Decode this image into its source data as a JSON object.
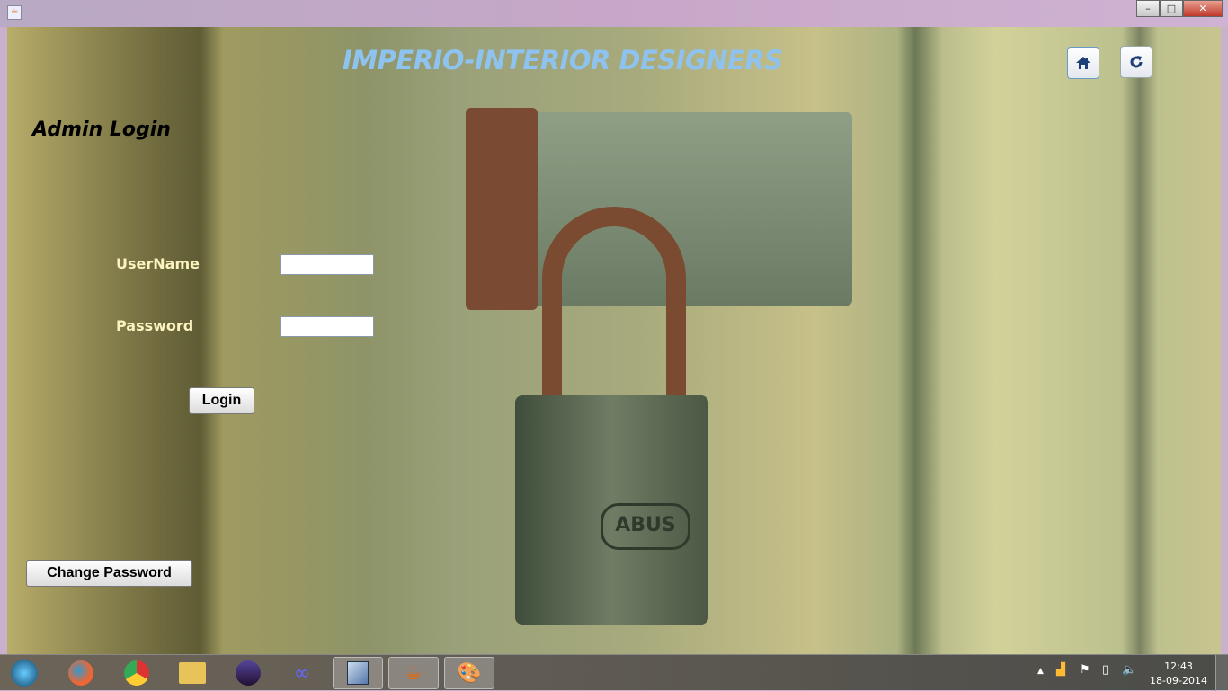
{
  "window": {
    "minimize": "–",
    "maximize": "□",
    "close": "✕"
  },
  "header": {
    "title": "IMPERIO-INTERIOR DESIGNERS",
    "home_icon": "home-icon",
    "refresh_icon": "refresh-icon"
  },
  "login": {
    "heading": "Admin Login",
    "username_label": "UserName",
    "username_value": "",
    "password_label": "Password",
    "password_value": "",
    "login_button": "Login",
    "change_password_button": "Change Password"
  },
  "background": {
    "lock_brand": "ABUS"
  },
  "taskbar": {
    "apps": [
      "start",
      "firefox",
      "chrome",
      "explorer",
      "eclipse",
      "infinity",
      "virtualbox",
      "java",
      "paint"
    ],
    "time": "12:43",
    "date": "18-09-2014"
  }
}
